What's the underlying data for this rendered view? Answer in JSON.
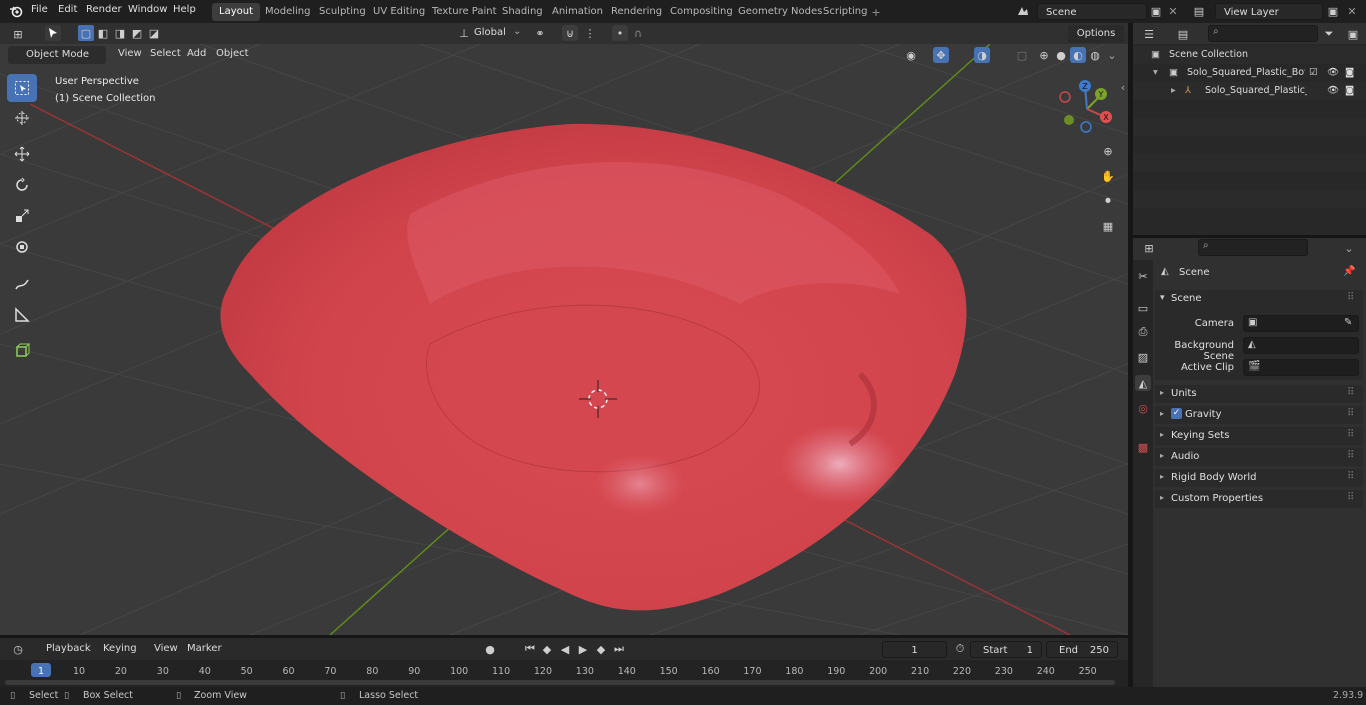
{
  "menu": {
    "file": "File",
    "edit": "Edit",
    "render": "Render",
    "window": "Window",
    "help": "Help"
  },
  "workspaces": [
    "Layout",
    "Modeling",
    "Sculpting",
    "UV Editing",
    "Texture Paint",
    "Shading",
    "Animation",
    "Rendering",
    "Compositing",
    "Geometry Nodes",
    "Scripting"
  ],
  "scene_field": "Scene",
  "view_layer_field": "View Layer",
  "viewport_header": {
    "mode": "Object Mode",
    "view": "View",
    "select": "Select",
    "add": "Add",
    "object": "Object",
    "transform": "Global",
    "options": "Options"
  },
  "overlay": {
    "perspective": "User Perspective",
    "collection": "(1) Scene Collection"
  },
  "gizmo": {
    "x": "X",
    "y": "Y",
    "z": "Z"
  },
  "outliner": {
    "root": "Scene Collection",
    "item1": "Solo_Squared_Plastic_Bowl_R",
    "item2": "Solo_Squared_Plastic_Bo"
  },
  "properties": {
    "header": "Scene",
    "panel": "Scene",
    "camera_label": "Camera",
    "bg_scene_label": "Background Scene",
    "active_clip_label": "Active Clip",
    "sections": [
      "Units",
      "Gravity",
      "Keying Sets",
      "Audio",
      "Rigid Body World",
      "Custom Properties"
    ]
  },
  "timeline": {
    "playback": "Playback",
    "keying": "Keying",
    "view": "View",
    "marker": "Marker",
    "current_frame": "1",
    "start_label": "Start",
    "start": "1",
    "end_label": "End",
    "end": "250",
    "ticks": [
      "1",
      "10",
      "20",
      "30",
      "40",
      "50",
      "60",
      "70",
      "80",
      "90",
      "100",
      "110",
      "120",
      "130",
      "140",
      "150",
      "160",
      "170",
      "180",
      "190",
      "200",
      "210",
      "220",
      "230",
      "240",
      "250"
    ]
  },
  "status": {
    "select": "Select",
    "box_select": "Box Select",
    "zoom_view": "Zoom View",
    "lasso_select": "Lasso Select",
    "version": "2.93.9"
  },
  "colors": {
    "accent": "#4772b3",
    "object": "#d84a50",
    "axis_x": "#b03a3a",
    "axis_y": "#6a9a1f"
  }
}
